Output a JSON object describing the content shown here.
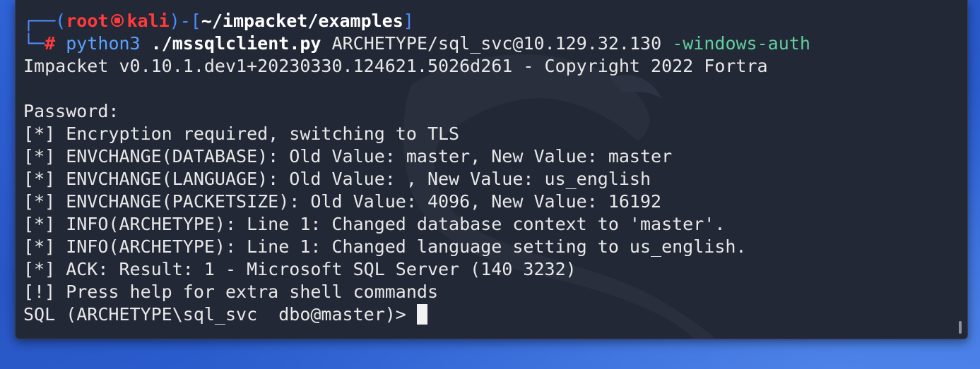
{
  "prompt": {
    "open_bracket": "┌──(",
    "user": "root",
    "host": "kali",
    "path_prefix": ")-[",
    "path": "~/impacket/examples",
    "path_suffix": "]",
    "branch": "└─",
    "symbol": "#"
  },
  "command": {
    "program": "python3",
    "script": "./mssqlclient.py",
    "target": "ARCHETYPE/sql_svc@10.129.32.130",
    "flag": "-windows-auth"
  },
  "output": [
    "Impacket v0.10.1.dev1+20230330.124621.5026d261 - Copyright 2022 Fortra",
    "",
    "Password:",
    "[*] Encryption required, switching to TLS",
    "[*] ENVCHANGE(DATABASE): Old Value: master, New Value: master",
    "[*] ENVCHANGE(LANGUAGE): Old Value: , New Value: us_english",
    "[*] ENVCHANGE(PACKETSIZE): Old Value: 4096, New Value: 16192",
    "[*] INFO(ARCHETYPE): Line 1: Changed database context to 'master'.",
    "[*] INFO(ARCHETYPE): Line 1: Changed language setting to us_english.",
    "[*] ACK: Result: 1 - Microsoft SQL Server (140 3232)",
    "[!] Press help for extra shell commands"
  ],
  "sql_prompt": "SQL (ARCHETYPE\\sql_svc  dbo@master)> ",
  "colors": {
    "terminal_bg": "#232836",
    "prompt_blue": "#4c8dff",
    "prompt_red": "#ff3b3b",
    "flag_green": "#5fd0a0"
  },
  "icons": {
    "host_separator": "kali-skull-icon"
  }
}
